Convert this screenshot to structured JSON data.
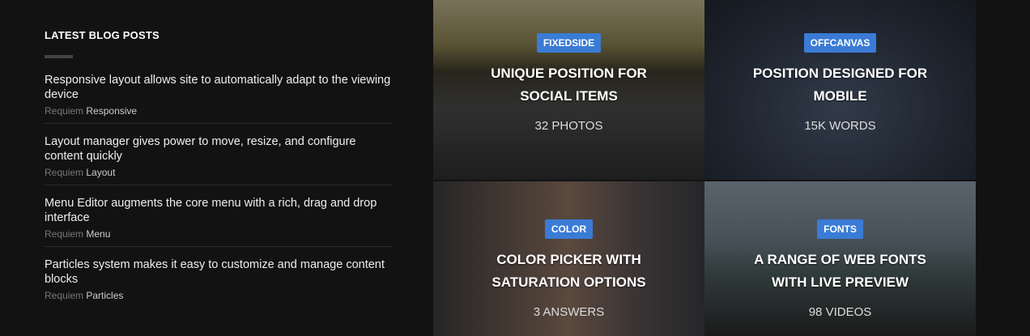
{
  "blog": {
    "heading": "LATEST BLOG POSTS",
    "posts": [
      {
        "title": "Responsive layout allows site to automatically adapt to the viewing device",
        "author": "Requiem",
        "category": "Responsive"
      },
      {
        "title": "Layout manager gives power to move, resize, and configure content quickly",
        "author": "Requiem",
        "category": "Layout"
      },
      {
        "title": "Menu Editor augments the core menu with a rich, drag and drop interface",
        "author": "Requiem",
        "category": "Menu"
      },
      {
        "title": "Particles system makes it easy to customize and manage content blocks",
        "author": "Requiem",
        "category": "Particles"
      }
    ]
  },
  "tiles": [
    {
      "badge": "FIXEDSIDE",
      "title": "UNIQUE POSITION FOR SOCIAL ITEMS",
      "sub": "32 PHOTOS"
    },
    {
      "badge": "OFFCANVAS",
      "title": "POSITION DESIGNED FOR MOBILE",
      "sub": "15K WORDS"
    },
    {
      "badge": "COLOR",
      "title": "COLOR PICKER WITH SATURATION OPTIONS",
      "sub": "3 ANSWERS"
    },
    {
      "badge": "FONTS",
      "title": "A RANGE OF WEB FONTS WITH LIVE PREVIEW",
      "sub": "98 VIDEOS"
    }
  ],
  "colors": {
    "badge": "#3a7bd5",
    "background": "#121212"
  }
}
